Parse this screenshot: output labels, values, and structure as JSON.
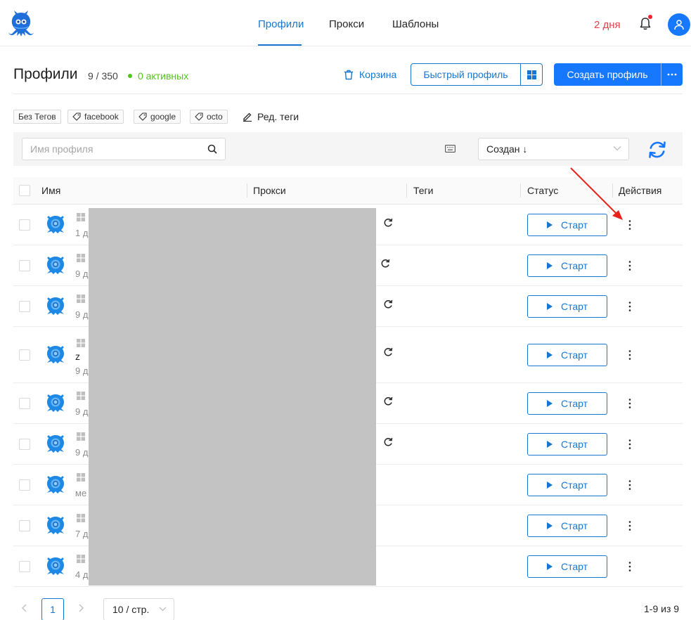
{
  "nav": {
    "tabs": [
      "Профили",
      "Прокси",
      "Шаблоны"
    ],
    "trial": "2 дня"
  },
  "header": {
    "title": "Профили",
    "count": "9 / 350",
    "active": "0 активных",
    "trash": "Корзина",
    "quick_profile": "Быстрый профиль",
    "create_profile": "Создать профиль"
  },
  "tags": [
    {
      "label": "Без Тегов",
      "icon": ""
    },
    {
      "label": "facebook",
      "icon": "tag-icon"
    },
    {
      "label": "google",
      "icon": "tag-icon"
    },
    {
      "label": "octo",
      "icon": "tag-icon"
    }
  ],
  "edit_tags": "Ред. теги",
  "filters": {
    "search_placeholder": "Имя профиля",
    "sort_value": "Создан ↓"
  },
  "table": {
    "columns": [
      "Имя",
      "Прокси",
      "Теги",
      "Статус",
      "Действия"
    ],
    "rows": [
      {
        "sub": "1 д",
        "name": "",
        "proxy_reload": true
      },
      {
        "sub": "9 д",
        "name": "",
        "proxy_reload": true
      },
      {
        "sub": "9 д",
        "name": "",
        "proxy_reload": true
      },
      {
        "sub": "9 д",
        "name": "z",
        "proxy_reload": true
      },
      {
        "sub": "9 д",
        "name": "",
        "proxy_reload": true
      },
      {
        "sub": "9 д",
        "name": "",
        "proxy_reload": true
      },
      {
        "sub": "ме",
        "name": "",
        "proxy_reload": false
      },
      {
        "sub": "7 д",
        "name": "",
        "proxy_reload": false
      },
      {
        "sub": "4 д",
        "name": "",
        "proxy_reload": false
      }
    ],
    "start_label": "Старт"
  },
  "pagination": {
    "current": "1",
    "page_size": "10 / стр.",
    "total": "1-9 из 9"
  },
  "colors": {
    "accent": "#1677d2",
    "primary": "#1677ff",
    "trial": "#e0424b",
    "active": "#52c41a",
    "annotation": "#e8221b"
  }
}
